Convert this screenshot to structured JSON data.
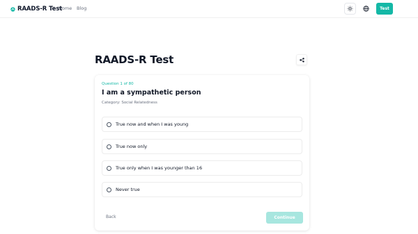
{
  "navbar": {
    "brand_text": "RAADS-R Test",
    "links": {
      "home": "Home",
      "blog": "Blog"
    },
    "test_button": "Test",
    "icons": {
      "brand": "brain-logo-icon",
      "theme": "sun-icon",
      "language": "globe-icon"
    }
  },
  "page": {
    "title": "RAADS-R Test"
  },
  "question": {
    "counter": "Question 1 of 80",
    "text": "I am a sympathetic person",
    "category": "Category: Social Relatedness",
    "options": [
      {
        "label": "True now and when I was young"
      },
      {
        "label": "True now only"
      },
      {
        "label": "True only when I was younger than 16"
      },
      {
        "label": "Never true"
      }
    ]
  },
  "actions": {
    "back": "Back",
    "continue": "Continue"
  },
  "colors": {
    "accent": "#14b8a6",
    "accent_disabled": "#a7e6df"
  }
}
